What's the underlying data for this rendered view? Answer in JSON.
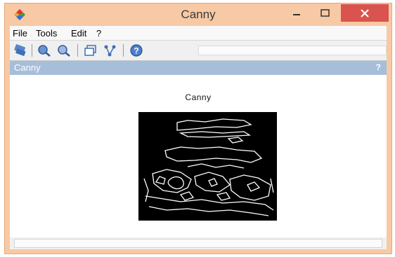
{
  "window": {
    "title": "Canny",
    "controls": {
      "minimize": "minimize",
      "maximize": "maximize",
      "close": "close"
    }
  },
  "menu": {
    "items": [
      {
        "label": "File"
      },
      {
        "label": "Tools"
      },
      {
        "label": "Edit"
      },
      {
        "label": "?"
      }
    ]
  },
  "toolbar": {
    "buttons": [
      {
        "icon": "save-icon"
      },
      {
        "icon": "zoom-in-icon"
      },
      {
        "icon": "zoom-out-icon"
      },
      {
        "icon": "window-icon"
      },
      {
        "icon": "graph-icon"
      },
      {
        "icon": "help-icon"
      }
    ]
  },
  "panel": {
    "title": "Canny",
    "help": "?"
  },
  "image": {
    "title": "Canny",
    "description_icon": "edge-detected-image"
  },
  "colors": {
    "titlebar": "#f7c9a4",
    "close_button": "#d9534f",
    "panel_header": "#a7bedb"
  }
}
